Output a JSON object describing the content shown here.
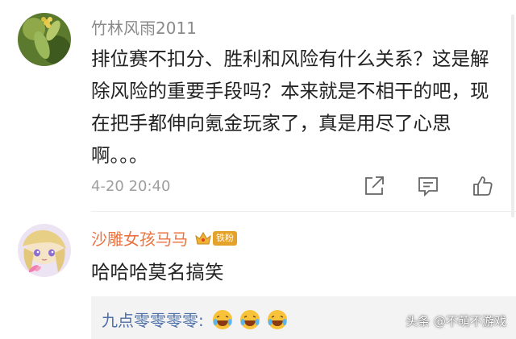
{
  "comments": [
    {
      "author": "竹林风雨2011",
      "text": "排位赛不扣分、胜利和风险有什么关系？这是解除风险的重要手段吗？本来就是不相干的吧，现在把手都伸向氪金玩家了，真是用尽了心思啊。。。",
      "timestamp": "4-20 20:40",
      "actions": [
        {
          "icon": "share-icon"
        },
        {
          "icon": "comment-icon"
        },
        {
          "icon": "like-icon"
        }
      ]
    },
    {
      "author": "沙雕女孩马马",
      "badge": {
        "icon": "crown-icon",
        "label": "铁粉"
      },
      "text": "哈哈哈莫名搞笑",
      "reply": {
        "name": "九点零零零零:",
        "emojis": [
          "laugh-cry-emoji",
          "laugh-cry-emoji",
          "laugh-cry-emoji"
        ]
      }
    }
  ],
  "watermark": "头条 @不萌不游戏",
  "colors": {
    "author_gray": "#8a8a8a",
    "author_fan": "#eb7340",
    "reply_link": "#4c6fa8",
    "badge_gold": "#e5a22b"
  }
}
